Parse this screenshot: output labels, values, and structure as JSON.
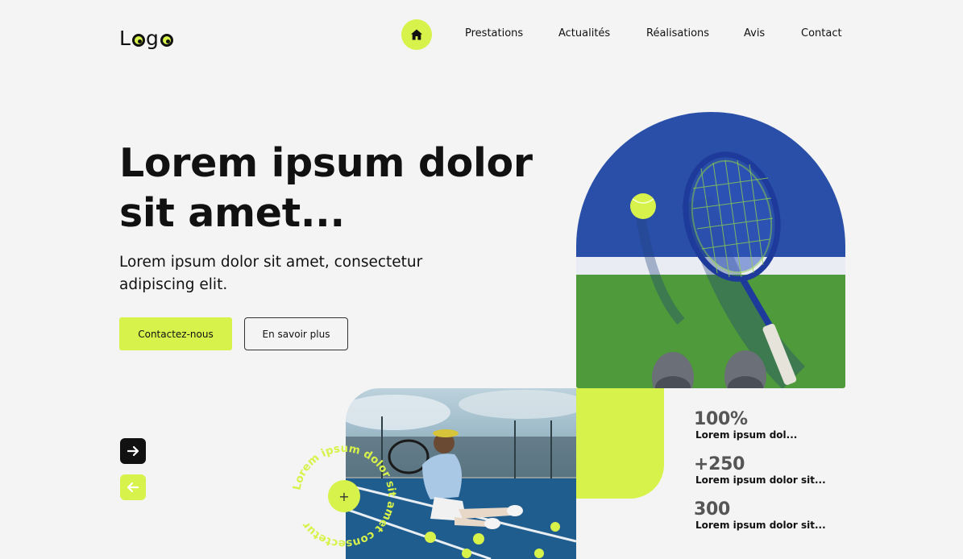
{
  "logo": {
    "text_l": "L",
    "text_g": "g"
  },
  "nav": {
    "home_icon": "home-icon",
    "items": [
      "Prestations",
      "Actualités",
      "Réalisations",
      "Avis",
      "Contact"
    ]
  },
  "hero": {
    "title": "Lorem ipsum dolor sit amet...",
    "subtitle": "Lorem ipsum dolor sit amet, consectetur adipiscing elit.",
    "primary_button": "Contactez-nous",
    "secondary_button": "En savoir plus"
  },
  "carousel": {
    "next_icon": "arrow-right-icon",
    "prev_icon": "arrow-left-icon"
  },
  "circle_badge": {
    "text": "Lorem ipsum dolor sit amet consectetur",
    "button_label": "+"
  },
  "stats": [
    {
      "value": "100%",
      "label": "Lorem ipsum dol..."
    },
    {
      "value": "+250",
      "label": "Lorem ipsum dolor sit..."
    },
    {
      "value": "300",
      "label": "Lorem ipsum dolor sit..."
    }
  ],
  "colors": {
    "accent": "#d7f24a",
    "background": "#f4f4f4",
    "text": "#111111",
    "court_blue": "#2a4fa8",
    "court_green": "#4f9a3a"
  }
}
